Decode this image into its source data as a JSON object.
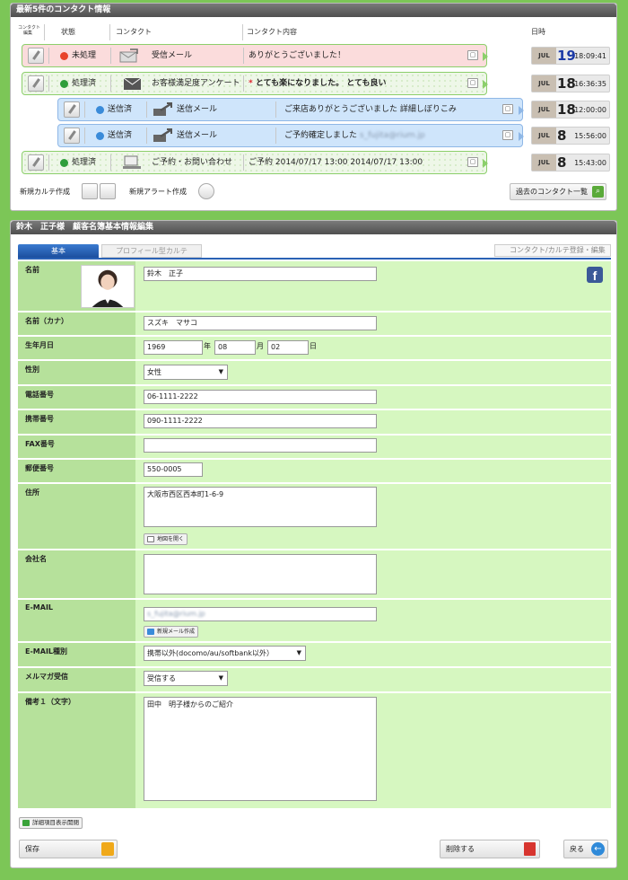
{
  "contacts_panel": {
    "title": "最新5件のコンタクト情報",
    "headers": {
      "edit": "コンタクト\n編集",
      "status": "状態",
      "contact": "コンタクト",
      "content": "コンタクト内容",
      "date": "日時"
    },
    "rows": [
      {
        "status": "未処理",
        "status_color": "#e8442b",
        "type": "受信メール",
        "content": "ありがとうございました！",
        "month": "JUL",
        "day": "19",
        "time": "18:09:41"
      },
      {
        "status": "処理済",
        "status_color": "#2f9e3b",
        "type": "お客様満足度アンケート",
        "content": "とても楽になりました。 とても良い",
        "month": "JUL",
        "day": "18",
        "time": "16:36:35"
      },
      {
        "status": "送信済",
        "status_color": "#3a8bd9",
        "type": "送信メール",
        "content": "ご来店ありがとうございました 詳細しぼりこみ",
        "month": "JUL",
        "day": "18",
        "time": "12:00:00"
      },
      {
        "status": "送信済",
        "status_color": "#3a8bd9",
        "type": "送信メール",
        "content": "ご予約確定しました",
        "content_blur": "s_fujita@rium.jp",
        "month": "JUL",
        "day": "8",
        "time": "15:56:00"
      },
      {
        "status": "処理済",
        "status_color": "#2f9e3b",
        "type": "ご予約・お問い合わせ",
        "content": "ご予約 2014/07/17 13:00 2014/07/17 13:00",
        "month": "JUL",
        "day": "8",
        "time": "15:43:00"
      }
    ],
    "new_karte": "新規カルテ作成",
    "new_alert": "新規アラート作成",
    "past_list": "過去のコンタクト一覧"
  },
  "form_panel": {
    "title": "鈴木　正子様　顧客名簿基本情報編集",
    "tabs": {
      "basic": "基本",
      "profile": "プロフィール型カルテ",
      "contact_reg": "コンタクト/カルテ登録・編集"
    },
    "labels": {
      "name": "名前",
      "kana": "名前（カナ）",
      "birth": "生年月日",
      "gender": "性別",
      "phone": "電話番号",
      "mobile": "携帯番号",
      "fax": "FAX番号",
      "zip": "郵便番号",
      "address": "住所",
      "company": "会社名",
      "email": "E-MAIL",
      "email_type": "E-MAIL種別",
      "magazine": "メルマガ受信",
      "note": "備考１（文字）"
    },
    "values": {
      "name": "鈴木　正子",
      "kana": "スズキ　マサコ",
      "year": "1969",
      "month": "08",
      "day": "02",
      "gender": "女性",
      "phone": "06-1111-2222",
      "mobile": "090-1111-2222",
      "fax": "",
      "zip": "550-0005",
      "address": "大阪市西区西本町1-6-9",
      "company": "",
      "email": "s_fujita@rium.jp",
      "email_type": "携帯以外(docomo/au/softbank以外）",
      "magazine": "受信する",
      "note": "田中　明子様からのご紹介"
    },
    "units": {
      "year": "年",
      "month": "月",
      "day": "日"
    },
    "map_button": "地図を開く",
    "new_mail_button": "新規メール作成",
    "details_toggle": "詳細項目表示開閉",
    "save": "保存",
    "delete": "削除する",
    "back": "戻る",
    "facebook": "f"
  }
}
